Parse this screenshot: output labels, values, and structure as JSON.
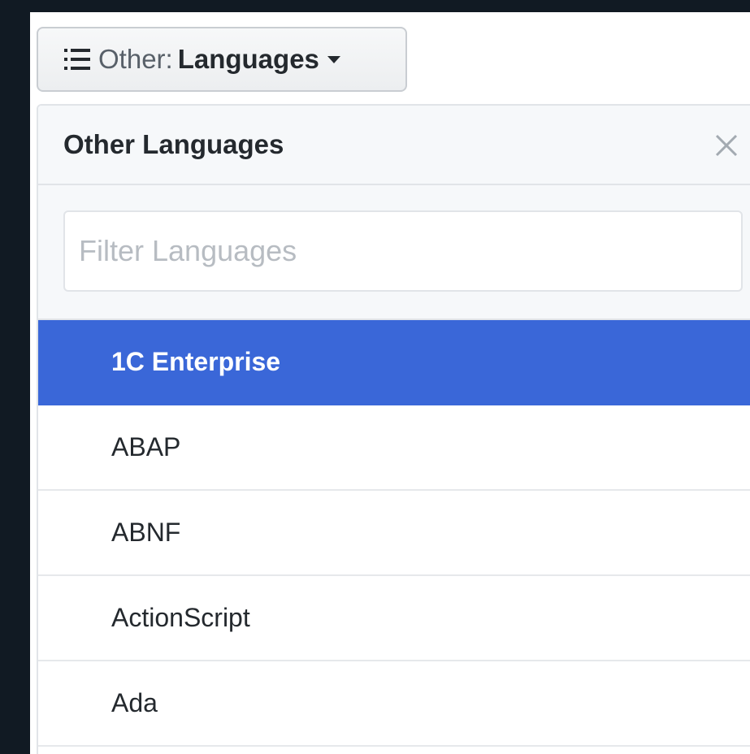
{
  "menu_button": {
    "prefix": "Other:",
    "value": "Languages",
    "icon": "list-icon"
  },
  "popover": {
    "title": "Other Languages",
    "close_icon": "close-icon",
    "filter_placeholder": "Filter Languages",
    "filter_value": "",
    "items": [
      {
        "label": "1C Enterprise",
        "selected": true
      },
      {
        "label": "ABAP",
        "selected": false
      },
      {
        "label": "ABNF",
        "selected": false
      },
      {
        "label": "ActionScript",
        "selected": false
      },
      {
        "label": "Ada",
        "selected": false
      }
    ]
  },
  "colors": {
    "background": "#111a23",
    "selected_item": "#3a67d8",
    "header_bg": "#f6f8fa"
  }
}
